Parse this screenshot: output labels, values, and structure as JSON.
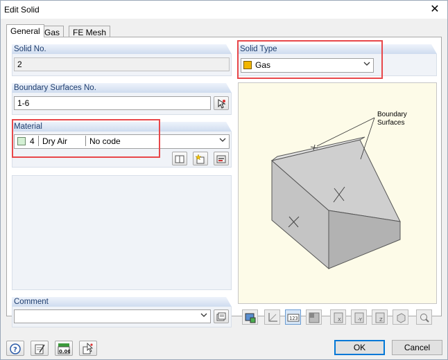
{
  "window": {
    "title": "Edit Solid"
  },
  "tabs": [
    {
      "label": "General"
    },
    {
      "label": "Gas"
    },
    {
      "label": "FE Mesh"
    }
  ],
  "solid_no": {
    "label": "Solid No.",
    "value": "2"
  },
  "solid_type": {
    "label": "Solid Type",
    "value": "Gas",
    "swatch_color": "#f2b600"
  },
  "boundary": {
    "label": "Boundary Surfaces No.",
    "value": "1-6"
  },
  "material": {
    "label": "Material",
    "number": "4",
    "name": "Dry Air",
    "code": "No code",
    "swatch_color": "#d4f0d4"
  },
  "comment": {
    "label": "Comment",
    "value": ""
  },
  "drawing": {
    "annotation_line1": "Boundary",
    "annotation_line2": "Surfaces"
  },
  "buttons": {
    "ok": "OK",
    "cancel": "Cancel"
  },
  "colors": {
    "highlight": "#e8474a",
    "accent": "#0078d7",
    "group_header_text": "#1c3c6e"
  }
}
